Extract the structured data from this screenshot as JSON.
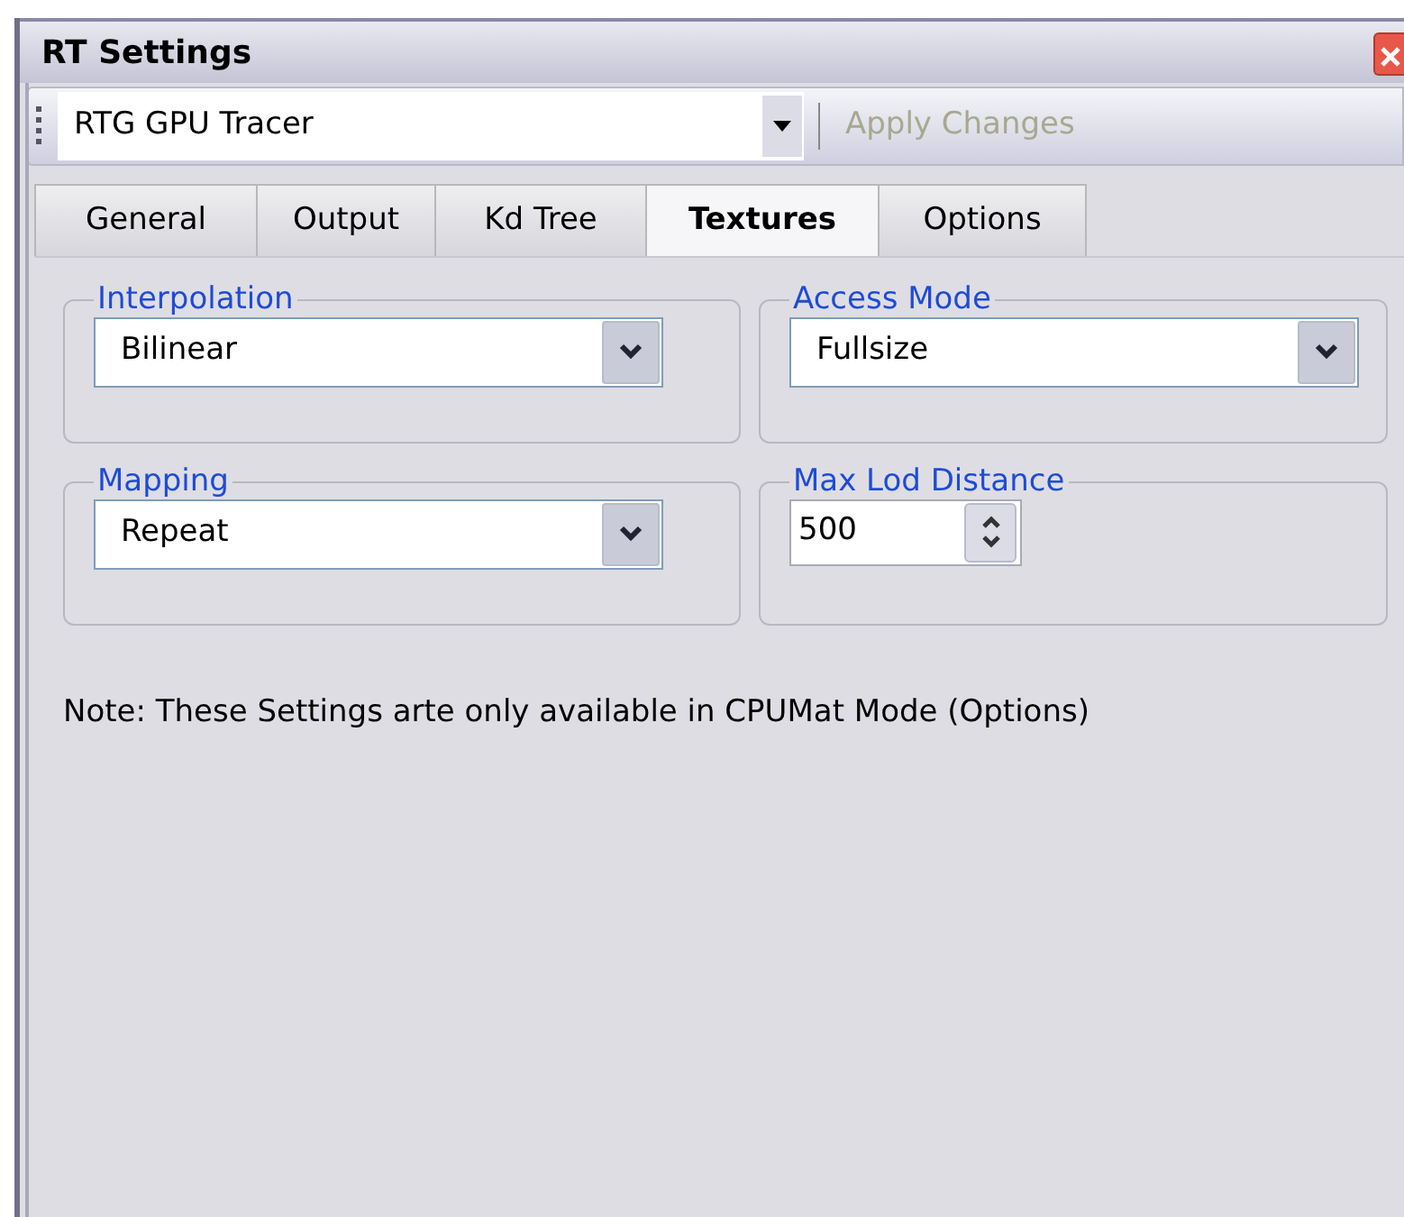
{
  "window": {
    "title": "RT Settings"
  },
  "toolbar": {
    "renderer": "RTG GPU Tracer",
    "apply_button": {
      "label": "Apply Changes",
      "disabled": true
    }
  },
  "tabs": [
    {
      "label": "General",
      "selected": false
    },
    {
      "label": "Output",
      "selected": false
    },
    {
      "label": "Kd Tree",
      "selected": false
    },
    {
      "label": "Textures",
      "selected": true
    },
    {
      "label": "Options",
      "selected": false
    }
  ],
  "groups": [
    {
      "title": "Interpolation",
      "kind": "dropdown",
      "value": "Bilinear"
    },
    {
      "title": "Access Mode",
      "kind": "dropdown",
      "value": "Fullsize"
    },
    {
      "title": "Mapping",
      "kind": "dropdown",
      "value": "Repeat"
    },
    {
      "title": "Max Lod Distance",
      "kind": "spinner",
      "value": "500"
    }
  ],
  "note": "Note: These Settings arte only available in CPUMat Mode (Options)"
}
